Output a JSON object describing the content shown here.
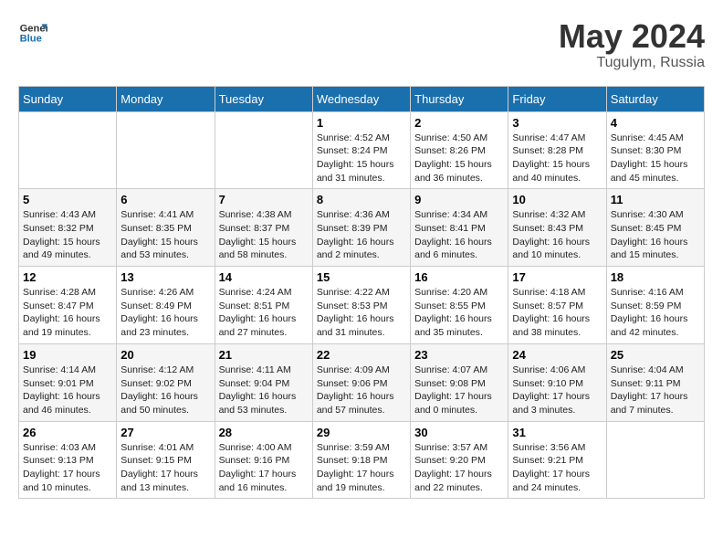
{
  "logo": {
    "line1": "General",
    "line2": "Blue"
  },
  "title": "May 2024",
  "location": "Tugulym, Russia",
  "weekdays": [
    "Sunday",
    "Monday",
    "Tuesday",
    "Wednesday",
    "Thursday",
    "Friday",
    "Saturday"
  ],
  "weeks": [
    [
      {
        "day": "",
        "detail": ""
      },
      {
        "day": "",
        "detail": ""
      },
      {
        "day": "",
        "detail": ""
      },
      {
        "day": "1",
        "detail": "Sunrise: 4:52 AM\nSunset: 8:24 PM\nDaylight: 15 hours\nand 31 minutes."
      },
      {
        "day": "2",
        "detail": "Sunrise: 4:50 AM\nSunset: 8:26 PM\nDaylight: 15 hours\nand 36 minutes."
      },
      {
        "day": "3",
        "detail": "Sunrise: 4:47 AM\nSunset: 8:28 PM\nDaylight: 15 hours\nand 40 minutes."
      },
      {
        "day": "4",
        "detail": "Sunrise: 4:45 AM\nSunset: 8:30 PM\nDaylight: 15 hours\nand 45 minutes."
      }
    ],
    [
      {
        "day": "5",
        "detail": "Sunrise: 4:43 AM\nSunset: 8:32 PM\nDaylight: 15 hours\nand 49 minutes."
      },
      {
        "day": "6",
        "detail": "Sunrise: 4:41 AM\nSunset: 8:35 PM\nDaylight: 15 hours\nand 53 minutes."
      },
      {
        "day": "7",
        "detail": "Sunrise: 4:38 AM\nSunset: 8:37 PM\nDaylight: 15 hours\nand 58 minutes."
      },
      {
        "day": "8",
        "detail": "Sunrise: 4:36 AM\nSunset: 8:39 PM\nDaylight: 16 hours\nand 2 minutes."
      },
      {
        "day": "9",
        "detail": "Sunrise: 4:34 AM\nSunset: 8:41 PM\nDaylight: 16 hours\nand 6 minutes."
      },
      {
        "day": "10",
        "detail": "Sunrise: 4:32 AM\nSunset: 8:43 PM\nDaylight: 16 hours\nand 10 minutes."
      },
      {
        "day": "11",
        "detail": "Sunrise: 4:30 AM\nSunset: 8:45 PM\nDaylight: 16 hours\nand 15 minutes."
      }
    ],
    [
      {
        "day": "12",
        "detail": "Sunrise: 4:28 AM\nSunset: 8:47 PM\nDaylight: 16 hours\nand 19 minutes."
      },
      {
        "day": "13",
        "detail": "Sunrise: 4:26 AM\nSunset: 8:49 PM\nDaylight: 16 hours\nand 23 minutes."
      },
      {
        "day": "14",
        "detail": "Sunrise: 4:24 AM\nSunset: 8:51 PM\nDaylight: 16 hours\nand 27 minutes."
      },
      {
        "day": "15",
        "detail": "Sunrise: 4:22 AM\nSunset: 8:53 PM\nDaylight: 16 hours\nand 31 minutes."
      },
      {
        "day": "16",
        "detail": "Sunrise: 4:20 AM\nSunset: 8:55 PM\nDaylight: 16 hours\nand 35 minutes."
      },
      {
        "day": "17",
        "detail": "Sunrise: 4:18 AM\nSunset: 8:57 PM\nDaylight: 16 hours\nand 38 minutes."
      },
      {
        "day": "18",
        "detail": "Sunrise: 4:16 AM\nSunset: 8:59 PM\nDaylight: 16 hours\nand 42 minutes."
      }
    ],
    [
      {
        "day": "19",
        "detail": "Sunrise: 4:14 AM\nSunset: 9:01 PM\nDaylight: 16 hours\nand 46 minutes."
      },
      {
        "day": "20",
        "detail": "Sunrise: 4:12 AM\nSunset: 9:02 PM\nDaylight: 16 hours\nand 50 minutes."
      },
      {
        "day": "21",
        "detail": "Sunrise: 4:11 AM\nSunset: 9:04 PM\nDaylight: 16 hours\nand 53 minutes."
      },
      {
        "day": "22",
        "detail": "Sunrise: 4:09 AM\nSunset: 9:06 PM\nDaylight: 16 hours\nand 57 minutes."
      },
      {
        "day": "23",
        "detail": "Sunrise: 4:07 AM\nSunset: 9:08 PM\nDaylight: 17 hours\nand 0 minutes."
      },
      {
        "day": "24",
        "detail": "Sunrise: 4:06 AM\nSunset: 9:10 PM\nDaylight: 17 hours\nand 3 minutes."
      },
      {
        "day": "25",
        "detail": "Sunrise: 4:04 AM\nSunset: 9:11 PM\nDaylight: 17 hours\nand 7 minutes."
      }
    ],
    [
      {
        "day": "26",
        "detail": "Sunrise: 4:03 AM\nSunset: 9:13 PM\nDaylight: 17 hours\nand 10 minutes."
      },
      {
        "day": "27",
        "detail": "Sunrise: 4:01 AM\nSunset: 9:15 PM\nDaylight: 17 hours\nand 13 minutes."
      },
      {
        "day": "28",
        "detail": "Sunrise: 4:00 AM\nSunset: 9:16 PM\nDaylight: 17 hours\nand 16 minutes."
      },
      {
        "day": "29",
        "detail": "Sunrise: 3:59 AM\nSunset: 9:18 PM\nDaylight: 17 hours\nand 19 minutes."
      },
      {
        "day": "30",
        "detail": "Sunrise: 3:57 AM\nSunset: 9:20 PM\nDaylight: 17 hours\nand 22 minutes."
      },
      {
        "day": "31",
        "detail": "Sunrise: 3:56 AM\nSunset: 9:21 PM\nDaylight: 17 hours\nand 24 minutes."
      },
      {
        "day": "",
        "detail": ""
      }
    ]
  ]
}
